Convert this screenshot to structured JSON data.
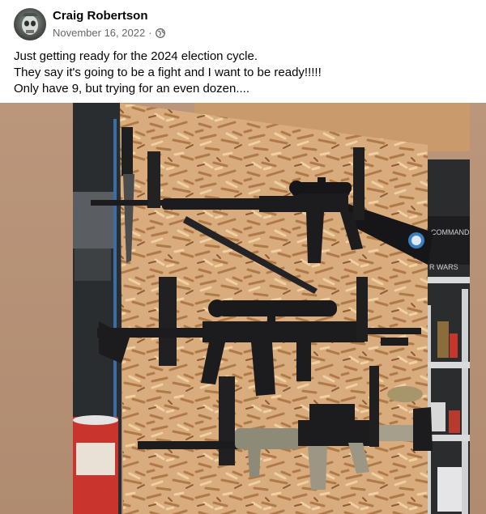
{
  "post": {
    "author_name": "Craig Robertson",
    "date": "November 16, 2022",
    "separator": "·",
    "privacy_icon": "globe-icon",
    "text_lines": [
      "Just getting ready for the 2024 election cycle.",
      "They say it's going to be a fight and I want to be ready!!!!!",
      "Only have 9, but trying for an even dozen...."
    ]
  },
  "photo": {
    "description_icon": "photo",
    "shelf_labels": [
      "COMMAND",
      "R WARS"
    ]
  },
  "colors": {
    "meta_text": "#65676b",
    "name_text": "#050505",
    "plywood": "#d8ac7d",
    "wall_brown": "#b58f74",
    "rifle_black": "#1c1c1e"
  }
}
